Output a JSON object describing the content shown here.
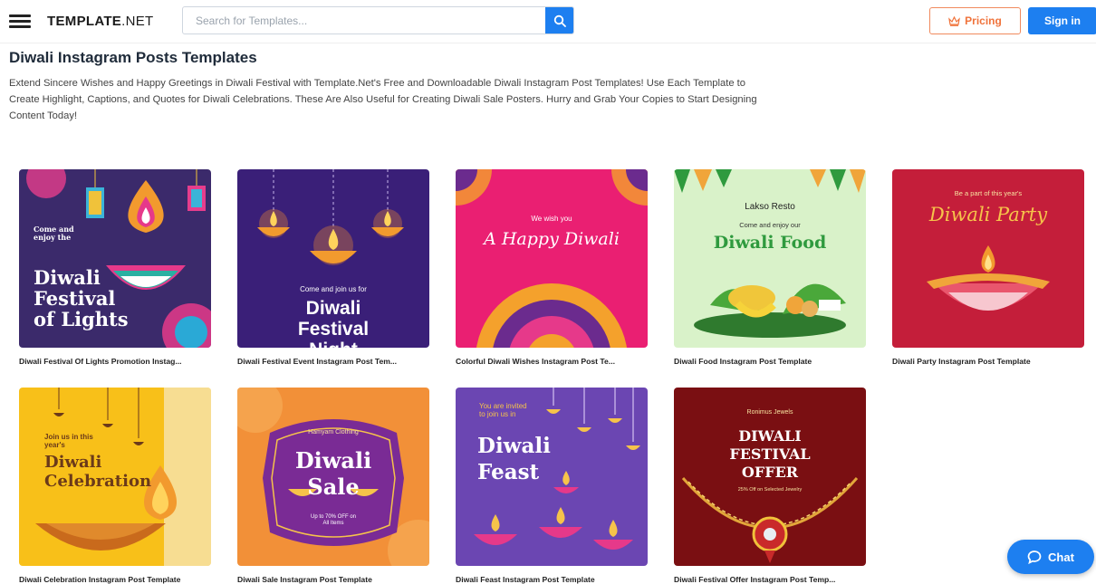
{
  "header": {
    "logo_bold": "TEMPLATE",
    "logo_rest": ".NET",
    "search_placeholder": "Search for Templates...",
    "pricing_label": "Pricing",
    "signin_label": "Sign in"
  },
  "page": {
    "title": "Diwali Instagram Posts Templates",
    "description": "Extend Sincere Wishes and Happy Greetings in Diwali Festival with Template.Net's Free and Downloadable Diwali Instagram Post Templates! Use Each Template to Create Highlight, Captions, and Quotes for Diwali Celebrations. These Are Also Useful for Creating Diwali Sale Posters. Hurry and Grab Your Copies to Start Designing Content Today!"
  },
  "templates": [
    {
      "caption": "Diwali Festival Of Lights Promotion Instag...",
      "art": {
        "small": "Come and enjoy the",
        "line1": "Diwali",
        "line2": "Festival",
        "line3": "of Lights"
      }
    },
    {
      "caption": "Diwali Festival Event Instagram Post Tem...",
      "art": {
        "small": "Come and join us for",
        "line1": "Diwali",
        "line2": "Festival",
        "line3": "Night"
      }
    },
    {
      "caption": "Colorful Diwali Wishes Instagram Post Te...",
      "art": {
        "small": "We wish you",
        "line1": "A Happy Diwali"
      }
    },
    {
      "caption": "Diwali Food Instagram Post Template",
      "art": {
        "brand": "Lakso Resto",
        "small": "Come and enjoy our",
        "line1": "Diwali Food"
      }
    },
    {
      "caption": "Diwali Party Instagram Post Template",
      "art": {
        "small": "Be a part of this year's",
        "line1": "Diwali Party"
      }
    },
    {
      "caption": "Diwali Celebration Instagram Post Template",
      "art": {
        "small": "Join us in this year's",
        "line1": "Diwali",
        "line2": "Celebration"
      }
    },
    {
      "caption": "Diwali Sale Instagram Post Template",
      "art": {
        "brand": "Hamyam Clothing",
        "line1": "Diwali",
        "line2": "Sale",
        "small": "Up to 70% OFF on All Items"
      }
    },
    {
      "caption": "Diwali Feast Instagram Post Template",
      "art": {
        "small": "You are invited to join us in",
        "line1": "Diwali",
        "line2": "Feast"
      }
    },
    {
      "caption": "Diwali Festival Offer Instagram Post Temp...",
      "art": {
        "brand": "Ronimus Jewels",
        "line1": "DIWALI",
        "line2": "FESTIVAL",
        "line3": "OFFER",
        "small": "25% Off on Selected Jewelry"
      }
    }
  ],
  "chat": {
    "label": "Chat"
  },
  "colors": {
    "accent": "#1d7ff0",
    "pricing": "#f0733b"
  }
}
